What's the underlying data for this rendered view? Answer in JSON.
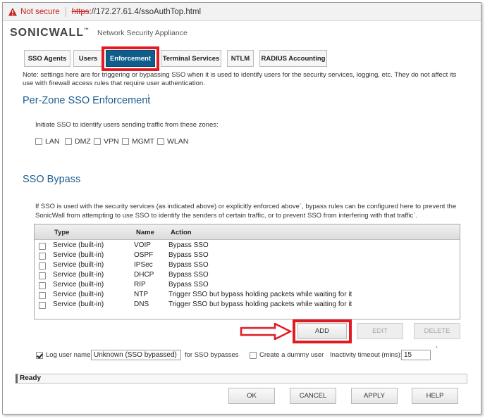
{
  "address_bar": {
    "not_secure": "Not secure",
    "url_scheme": "https",
    "url_rest": "://172.27.61.4/ssoAuthTop.html"
  },
  "header": {
    "brand": "SONICWALL",
    "brand_mark": "™",
    "subtitle": "Network Security Appliance"
  },
  "tabs": [
    {
      "label": "SSO Agents"
    },
    {
      "label": "Users"
    },
    {
      "label": "Enforcement"
    },
    {
      "label": "Terminal Services"
    },
    {
      "label": "NTLM"
    },
    {
      "label": "RADIUS Accounting"
    }
  ],
  "note": "Note: settings here are for triggering or bypassing SSO when it is used to identify users for the security services, logging, etc. They do not affect its use with firewall access rules that require user authentication.",
  "per_zone": {
    "title": "Per-Zone SSO Enforcement",
    "tick": "ˋ",
    "instruction": "Initiate SSO to identify users sending traffic from these zones:",
    "zones": [
      "LAN",
      "DMZ",
      "VPN",
      "MGMT",
      "WLAN"
    ]
  },
  "bypass": {
    "title": "SSO Bypass",
    "paragraph_1": "If SSO is used with the security services (as indicated above) or explicitly enforced above",
    "paragraph_tick": "ˋ",
    "paragraph_2": ", bypass rules can be configured here to prevent the SonicWall from attempting to use SSO to identify the senders of certain traffic, or to prevent SSO from interfering with that traffic",
    "paragraph_end": "ˋ."
  },
  "table": {
    "headers": {
      "type": "Type",
      "name": "Name",
      "action": "Action"
    },
    "rows": [
      {
        "type": "Service (built-in)",
        "name": "VOIP",
        "action": "Bypass SSO"
      },
      {
        "type": "Service (built-in)",
        "name": "OSPF",
        "action": "Bypass SSO"
      },
      {
        "type": "Service (built-in)",
        "name": "IPSec",
        "action": "Bypass SSO"
      },
      {
        "type": "Service (built-in)",
        "name": "DHCP",
        "action": "Bypass SSO"
      },
      {
        "type": "Service (built-in)",
        "name": "RIP",
        "action": "Bypass SSO"
      },
      {
        "type": "Service (built-in)",
        "name": "NTP",
        "action": "Trigger SSO but bypass holding packets while waiting for it"
      },
      {
        "type": "Service (built-in)",
        "name": "DNS",
        "action": "Trigger SSO but bypass holding packets while waiting for it"
      }
    ]
  },
  "table_buttons": {
    "add": "ADD",
    "edit": "EDIT",
    "delete": "DELETE"
  },
  "options": {
    "log_user_name": "Log user name",
    "log_user_value": "Unknown (SSO bypassed)",
    "for_sso_bypasses": "for SSO bypasses",
    "create_dummy_user": "Create a dummy user",
    "inactivity_timeout": "Inactivity timeout (mins):",
    "inactivity_value": "15",
    "tick": "ˋ"
  },
  "status": "Ready",
  "footer_buttons": {
    "ok": "OK",
    "cancel": "CANCEL",
    "apply": "APPLY",
    "help": "HELP"
  },
  "colors": {
    "accent": "#1a5c8e",
    "active_tab": "#0e5d8a",
    "highlight": "#e21b23",
    "not_secure": "#c5221f"
  }
}
